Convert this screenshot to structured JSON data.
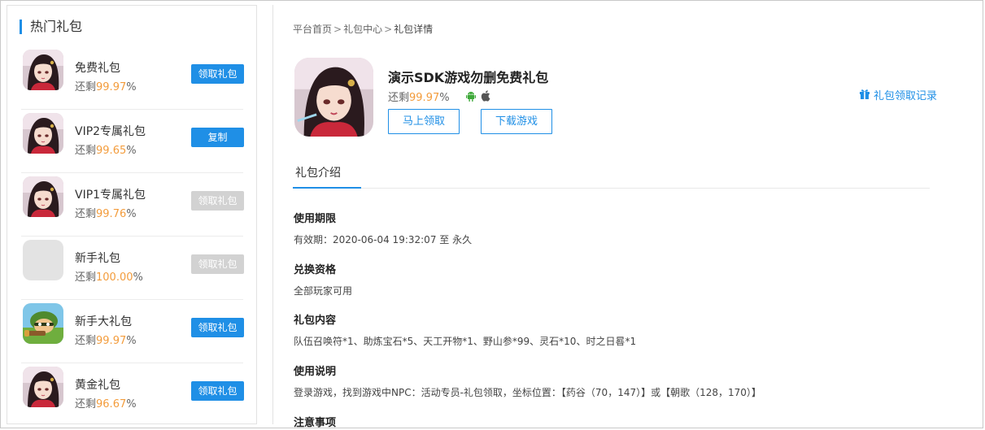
{
  "sidebar": {
    "title": "热门礼包",
    "items": [
      {
        "name": "免费礼包",
        "remain_prefix": "还剩",
        "remain_pct": "99.97",
        "remain_suffix": "%",
        "button": "领取礼包",
        "button_state": "active",
        "icon": "game-avatar-icon"
      },
      {
        "name": "VIP2专属礼包",
        "remain_prefix": "还剩",
        "remain_pct": "99.65",
        "remain_suffix": "%",
        "button": "复制",
        "button_state": "active",
        "icon": "game-avatar-icon"
      },
      {
        "name": "VIP1专属礼包",
        "remain_prefix": "还剩",
        "remain_pct": "99.76",
        "remain_suffix": "%",
        "button": "领取礼包",
        "button_state": "disabled",
        "icon": "game-avatar-icon"
      },
      {
        "name": "新手礼包",
        "remain_prefix": "还剩",
        "remain_pct": "100.00",
        "remain_suffix": "%",
        "button": "领取礼包",
        "button_state": "disabled",
        "icon": "placeholder-icon"
      },
      {
        "name": "新手大礼包",
        "remain_prefix": "还剩",
        "remain_pct": "99.97",
        "remain_suffix": "%",
        "button": "领取礼包",
        "button_state": "active",
        "icon": "soldier-game-icon"
      },
      {
        "name": "黄金礼包",
        "remain_prefix": "还剩",
        "remain_pct": "96.67",
        "remain_suffix": "%",
        "button": "领取礼包",
        "button_state": "active",
        "icon": "game-avatar-icon"
      }
    ]
  },
  "breadcrumb": {
    "home": "平台首页",
    "center": "礼包中心",
    "current": "礼包详情",
    "sep": ">"
  },
  "gift": {
    "title": "演示SDK游戏勿删免费礼包",
    "remain_prefix": "还剩",
    "remain_pct": "99.97",
    "remain_suffix": "%",
    "platforms": [
      "android-icon",
      "apple-icon"
    ],
    "claim_label": "马上领取",
    "download_label": "下载游戏",
    "record_label": "礼包领取记录"
  },
  "tabs": [
    {
      "label": "礼包介绍"
    }
  ],
  "sections": [
    {
      "title": "使用期限",
      "body": "有效期：2020-06-04 19:32:07 至 永久"
    },
    {
      "title": "兑换资格",
      "body": "全部玩家可用"
    },
    {
      "title": "礼包内容",
      "body": "队伍召唤符*1、助炼宝石*5、天工开物*1、野山参*99、灵石*10、时之日晷*1"
    },
    {
      "title": "使用说明",
      "body": "登录游戏，找到游戏中NPC：活动专员-礼包领取，坐标位置：【药谷（70，147）】或【朝歌（128，170）】"
    },
    {
      "title": "注意事项",
      "body": ""
    }
  ],
  "colors": {
    "accent": "#1f8fe6",
    "percent": "#f39c3c",
    "disabled": "#d2d2d2"
  }
}
